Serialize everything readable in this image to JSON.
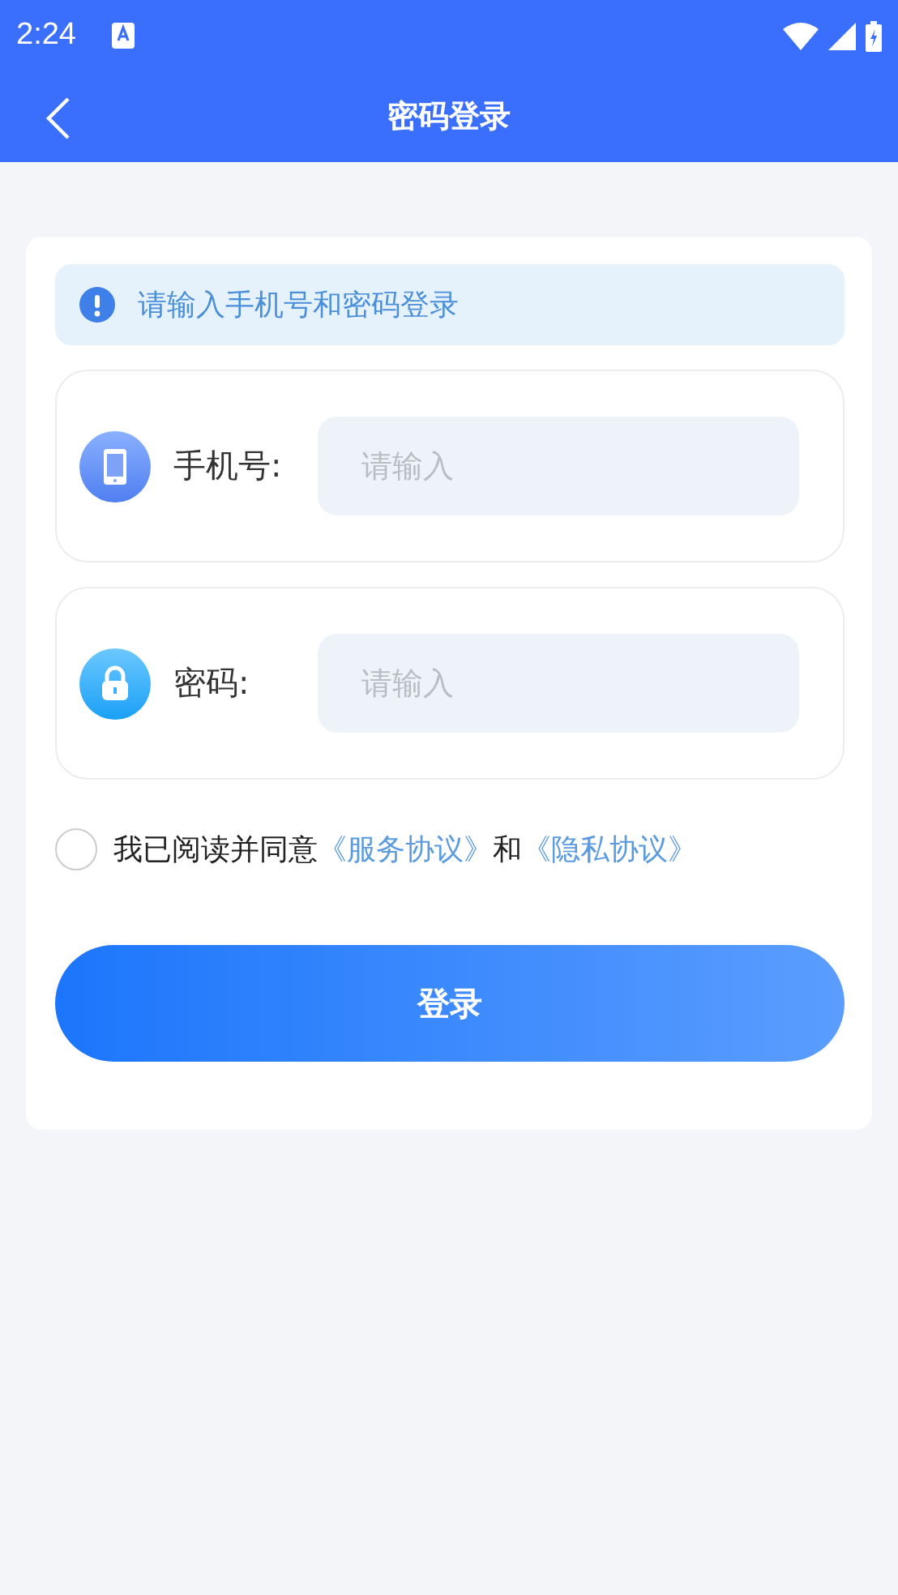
{
  "status_bar": {
    "time": "2:24"
  },
  "header": {
    "title": "密码登录"
  },
  "notice": {
    "text": "请输入手机号和密码登录"
  },
  "fields": [
    {
      "kind": "phone",
      "label": "手机号:",
      "placeholder": "请输入"
    },
    {
      "kind": "password",
      "label": "密码:",
      "placeholder": "请输入"
    }
  ],
  "agreement": {
    "checked": false,
    "before": "我已阅读并同意",
    "link_1": "《服务协议》",
    "middle": "和",
    "link_2": "《隐私协议》"
  },
  "login_button": {
    "label": "登录"
  }
}
